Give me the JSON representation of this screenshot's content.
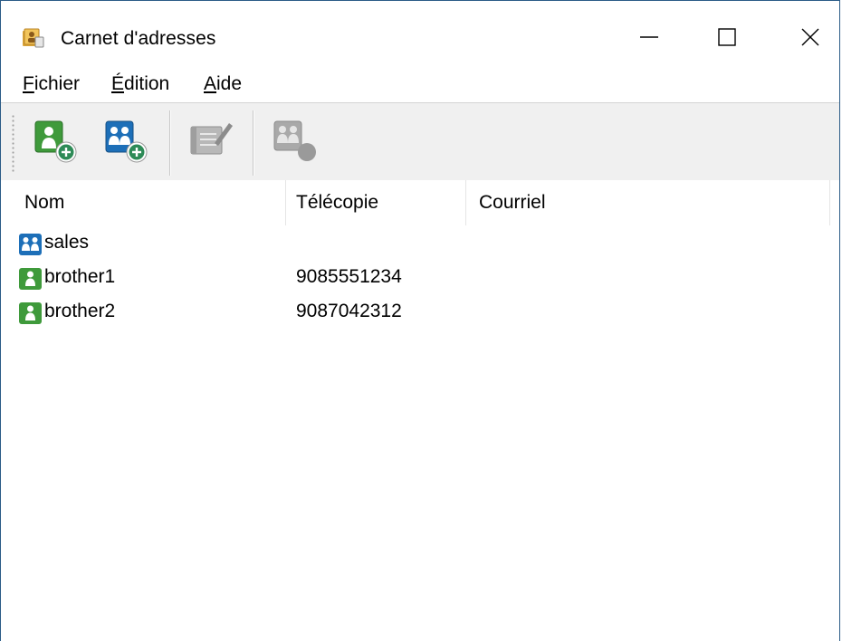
{
  "window": {
    "title": "Carnet d'adresses",
    "controls": {
      "minimize": "—",
      "maximize": "☐",
      "close": "✕"
    }
  },
  "menu": {
    "items": [
      {
        "mnemonic": "F",
        "rest": "ichier"
      },
      {
        "mnemonic": "É",
        "rest": "dition"
      },
      {
        "mnemonic": "A",
        "rest": "ide"
      }
    ]
  },
  "toolbar": {
    "buttons": [
      {
        "icon": "add-contact-icon",
        "enabled": true
      },
      {
        "icon": "add-group-icon",
        "enabled": true
      },
      {
        "icon": "edit-entry-icon",
        "enabled": false
      },
      {
        "icon": "send-group-icon",
        "enabled": false
      }
    ]
  },
  "list": {
    "columns": [
      "Nom",
      "Télécopie",
      "Courriel"
    ],
    "rows": [
      {
        "type": "group",
        "icon": "group-icon",
        "name": "sales",
        "fax": "",
        "email": ""
      },
      {
        "type": "contact",
        "icon": "contact-icon",
        "name": "brother1",
        "fax": "9085551234",
        "email": ""
      },
      {
        "type": "contact",
        "icon": "contact-icon",
        "name": "brother2",
        "fax": "9087042312",
        "email": ""
      }
    ]
  },
  "colors": {
    "contact_green": "#3f9a3b",
    "group_blue": "#1d6fb8",
    "toolbar_bg": "#f0f0f0",
    "window_border": "#2b5b87"
  }
}
